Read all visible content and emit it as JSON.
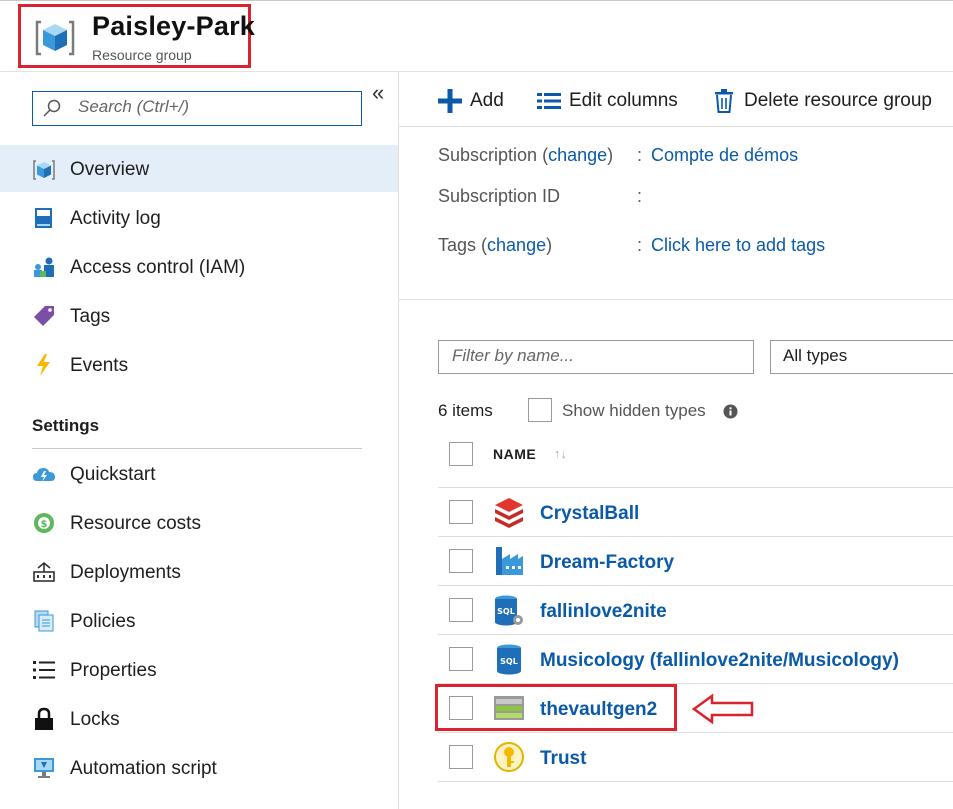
{
  "header": {
    "title": "Paisley-Park",
    "subtitle": "Resource group",
    "icon": "resource-group-cube-icon",
    "annotation_color": "#d9242f"
  },
  "sidebar": {
    "search_placeholder": "Search (Ctrl+/)",
    "collapse_glyph": "«",
    "items": [
      {
        "label": "Overview",
        "icon": "overview-cube-icon",
        "selected": true
      },
      {
        "label": "Activity log",
        "icon": "activity-log-icon"
      },
      {
        "label": "Access control (IAM)",
        "icon": "people-icon"
      },
      {
        "label": "Tags",
        "icon": "tag-icon"
      },
      {
        "label": "Events",
        "icon": "lightning-icon"
      }
    ],
    "settings_heading": "Settings",
    "settings_items": [
      {
        "label": "Quickstart",
        "icon": "cloud-icon"
      },
      {
        "label": "Resource costs",
        "icon": "cost-icon"
      },
      {
        "label": "Deployments",
        "icon": "deployments-icon"
      },
      {
        "label": "Policies",
        "icon": "policies-icon"
      },
      {
        "label": "Properties",
        "icon": "properties-icon"
      },
      {
        "label": "Locks",
        "icon": "lock-icon"
      },
      {
        "label": "Automation script",
        "icon": "automation-monitor-icon"
      }
    ]
  },
  "toolbar": {
    "add_label": "Add",
    "edit_columns_label": "Edit columns",
    "delete_label": "Delete resource group"
  },
  "essentials": {
    "subscription_label": "Subscription",
    "subscription_change": "change",
    "subscription_value": "Compte de démos",
    "subscription_id_label": "Subscription ID",
    "tags_label": "Tags",
    "tags_change": "change",
    "tags_value": "Click here to add tags",
    "colon": ":"
  },
  "filter": {
    "placeholder": "Filter by name...",
    "type_selected": "All types",
    "item_count": "6 items",
    "show_hidden_label": "Show hidden types"
  },
  "table": {
    "name_header": "NAME",
    "sort_glyph": "↑↓",
    "rows": [
      {
        "name": "CrystalBall",
        "icon": "databricks-icon"
      },
      {
        "name": "Dream-Factory",
        "icon": "data-factory-icon"
      },
      {
        "name": "fallinlove2nite",
        "icon": "sql-server-icon"
      },
      {
        "name": "Musicology (fallinlove2nite/Musicology)",
        "icon": "sql-database-icon"
      },
      {
        "name": "thevaultgen2",
        "icon": "storage-account-icon",
        "highlighted": true
      },
      {
        "name": "Trust",
        "icon": "key-vault-icon"
      }
    ]
  },
  "colors": {
    "link": "#0a5aa8",
    "selected_bg": "#e3eef9",
    "annotation": "#d9242f"
  }
}
